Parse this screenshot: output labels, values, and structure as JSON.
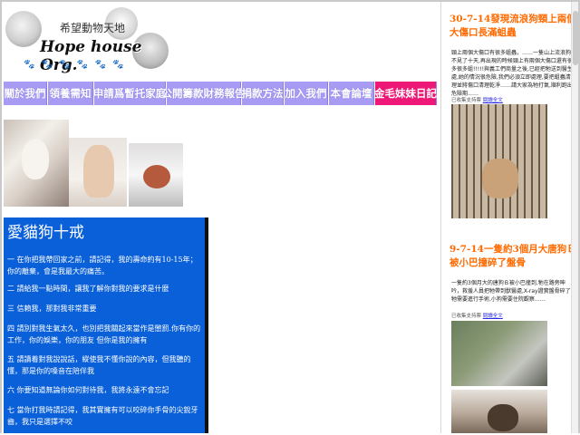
{
  "logo": {
    "subtitle": "希望動物天地",
    "title": "Hope house Org.",
    "paws": "🐾 🐾 🐾 🐾 🐾 🐾"
  },
  "nav": [
    {
      "label": "關於我們"
    },
    {
      "label": "領養需知"
    },
    {
      "label": "申請爲暫托家庭"
    },
    {
      "label": "公開籌款財務報告"
    },
    {
      "label": "捐款方法"
    },
    {
      "label": "加入我們"
    },
    {
      "label": "本會論壇"
    },
    {
      "label": "金毛妹妹日記",
      "highlight": true
    }
  ],
  "ten": {
    "title": "愛貓狗十戒",
    "items": [
      "一 在你把我帶回家之前，請記得，我的壽命約有10-15年；你的離棄，會是我最大的痛苦。",
      "二 請給我一點時間，讓我了解你對我的要求是什麼",
      "三 信賴我，那對我非常重要",
      "四 請別對我生氣太久，也別把我關起來當作是懲罰.你有你的工作，你的娛樂，你的朋友 但你是我的擁有",
      "五 請讀着對我說說話，縱使我不懂你說的內容，但我聽的懂，那是你的嗓音在陪伴我",
      "六 你要知道無論你如何對待我，我將永遠不會忘記",
      "七 當你打我時請記得，我其實擁有可以咬碎你手骨的尖銳牙齒，我只是選擇不咬"
    ]
  },
  "posts": [
    {
      "title": "30-7-14發現流浪狗頸上兩個大傷口長滿蛆蟲",
      "body": "頸上兩個大傷口有很多蛆蟲，……一隻山上流浪狗不見了十天,再出現的時候頸上有兩個大傷口還有很多很多蛆!!!!!與義工們商量之後,已經把牠送到醫生處,她的情況很危險,我們必須立即處理,要把蛆蟲清理並將傷口清理乾淨……請大家為牠打氣,順利跑出危險期……",
      "meta_prefix": "已收集支持票 ",
      "meta_link": "閱讀全文"
    },
    {
      "title": "9-7-14一隻約3個月大唐狗Ｂ被小巴撞碎了盤骨",
      "body": "一隻約3個月大的唐狗Ｂ被小巴撞到,牠在路旁呻吟，救援人員把牠帶到獸醫處,X-ray證實盤骨碎了,牠需要進行手術,小狗需要住院觀察……",
      "meta_prefix": "已收集支持票 ",
      "meta_link": "閱讀全文"
    }
  ],
  "colors": {
    "nav_purple": "#a89bf4",
    "nav_pink": "#ee1977",
    "box_blue": "#0a60d8",
    "post_title_orange": "#ff6a00"
  }
}
